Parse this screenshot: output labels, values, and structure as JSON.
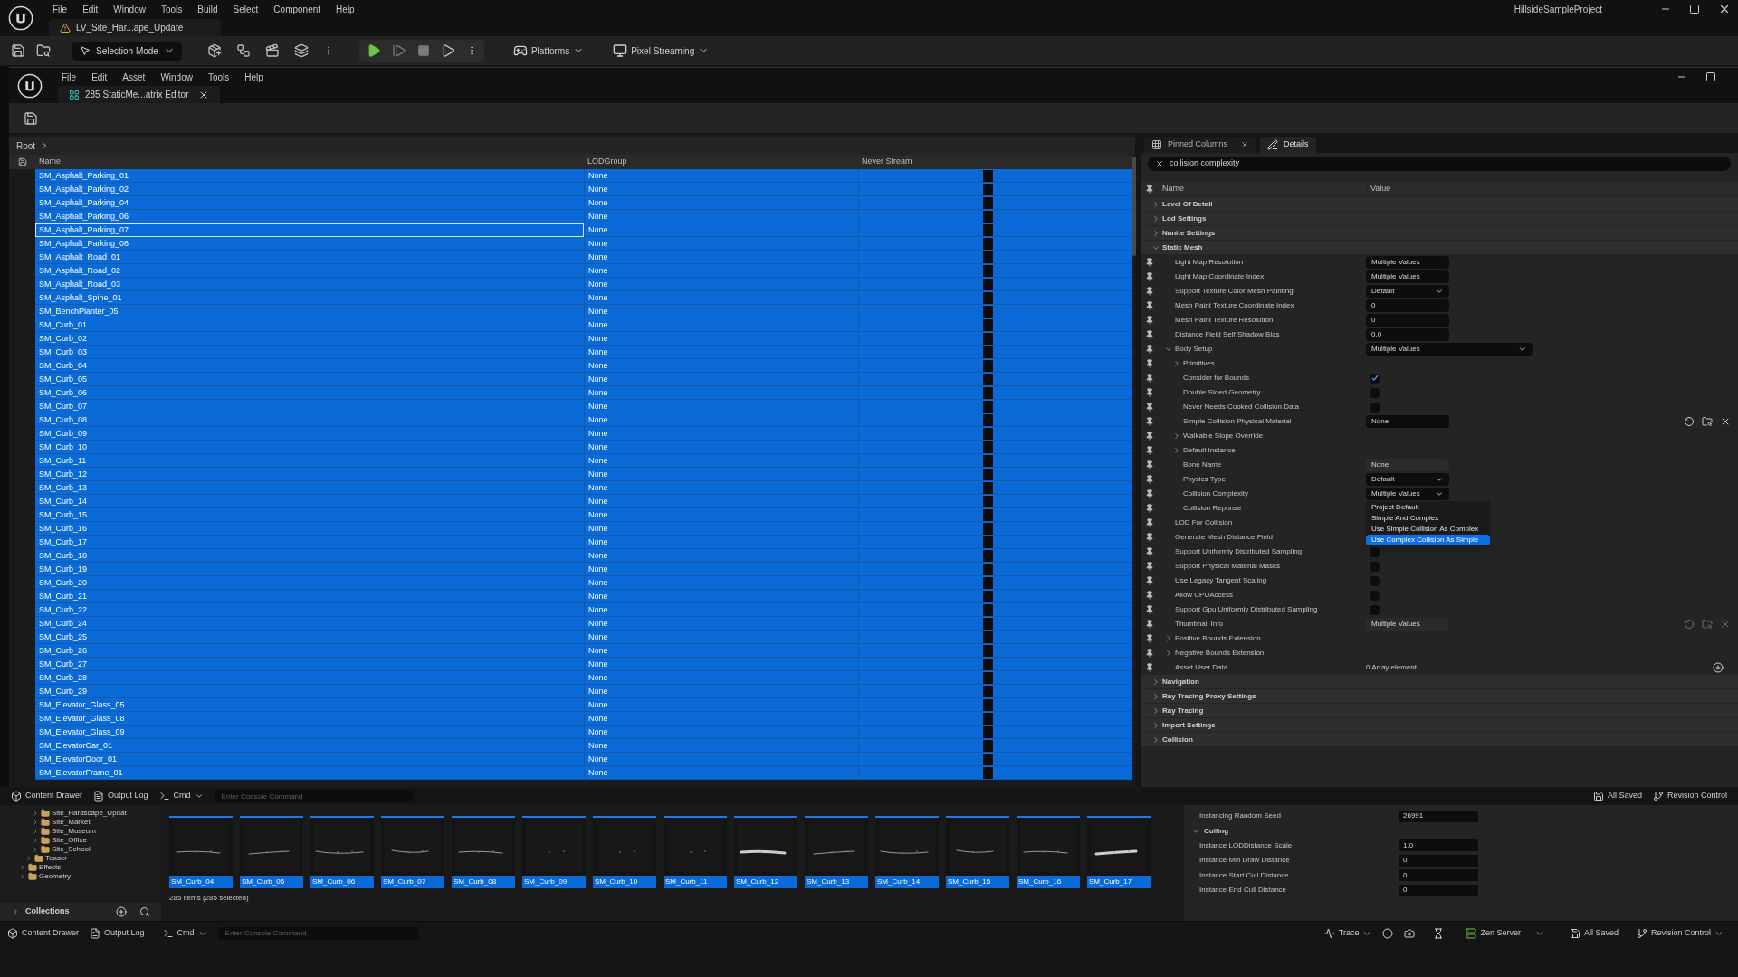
{
  "app": {
    "menu": [
      "File",
      "Edit",
      "Window",
      "Tools",
      "Build",
      "Select",
      "Component",
      "Help"
    ],
    "level_tab": "LV_Site_Har...ape_Update",
    "project": "HillsideSampleProject"
  },
  "toolbar": {
    "mode": "Selection Mode",
    "platforms": "Platforms",
    "streaming": "Pixel Streaming"
  },
  "editor": {
    "menu": [
      "File",
      "Edit",
      "Asset",
      "Window",
      "Tools",
      "Help"
    ],
    "tab": "285 StaticMe...atrix Editor",
    "breadcrumb": "Root",
    "table": {
      "columns": [
        "Name",
        "LODGroup",
        "Never Stream"
      ],
      "rows": [
        {
          "name": "SM_Asphalt_Parking_01",
          "lod_group": "None",
          "never_stream": false,
          "selected": true,
          "focused": false
        },
        {
          "name": "SM_Asphalt_Parking_02",
          "lod_group": "None",
          "never_stream": false,
          "selected": true,
          "focused": false
        },
        {
          "name": "SM_Asphalt_Parking_04",
          "lod_group": "None",
          "never_stream": false,
          "selected": true,
          "focused": false
        },
        {
          "name": "SM_Asphalt_Parking_06",
          "lod_group": "None",
          "never_stream": false,
          "selected": true,
          "focused": false
        },
        {
          "name": "SM_Asphalt_Parking_07",
          "lod_group": "None",
          "never_stream": false,
          "selected": true,
          "focused": true
        },
        {
          "name": "SM_Asphalt_Parking_08",
          "lod_group": "None",
          "never_stream": false,
          "selected": true,
          "focused": false
        },
        {
          "name": "SM_Asphalt_Road_01",
          "lod_group": "None",
          "never_stream": false,
          "selected": true,
          "focused": false
        },
        {
          "name": "SM_Asphalt_Road_02",
          "lod_group": "None",
          "never_stream": false,
          "selected": true,
          "focused": false
        },
        {
          "name": "SM_Asphalt_Road_03",
          "lod_group": "None",
          "never_stream": false,
          "selected": true,
          "focused": false
        },
        {
          "name": "SM_Asphalt_Spine_01",
          "lod_group": "None",
          "never_stream": false,
          "selected": true,
          "focused": false
        },
        {
          "name": "SM_BenchPlanter_05",
          "lod_group": "None",
          "never_stream": false,
          "selected": true,
          "focused": false
        },
        {
          "name": "SM_Curb_01",
          "lod_group": "None",
          "never_stream": false,
          "selected": true,
          "focused": false
        },
        {
          "name": "SM_Curb_02",
          "lod_group": "None",
          "never_stream": false,
          "selected": true,
          "focused": false
        },
        {
          "name": "SM_Curb_03",
          "lod_group": "None",
          "never_stream": false,
          "selected": true,
          "focused": false
        },
        {
          "name": "SM_Curb_04",
          "lod_group": "None",
          "never_stream": false,
          "selected": true,
          "focused": false
        },
        {
          "name": "SM_Curb_05",
          "lod_group": "None",
          "never_stream": false,
          "selected": true,
          "focused": false
        },
        {
          "name": "SM_Curb_06",
          "lod_group": "None",
          "never_stream": false,
          "selected": true,
          "focused": false
        },
        {
          "name": "SM_Curb_07",
          "lod_group": "None",
          "never_stream": false,
          "selected": true,
          "focused": false
        },
        {
          "name": "SM_Curb_08",
          "lod_group": "None",
          "never_stream": false,
          "selected": true,
          "focused": false
        },
        {
          "name": "SM_Curb_09",
          "lod_group": "None",
          "never_stream": false,
          "selected": true,
          "focused": false
        },
        {
          "name": "SM_Curb_10",
          "lod_group": "None",
          "never_stream": false,
          "selected": true,
          "focused": false
        },
        {
          "name": "SM_Curb_11",
          "lod_group": "None",
          "never_stream": false,
          "selected": true,
          "focused": false
        },
        {
          "name": "SM_Curb_12",
          "lod_group": "None",
          "never_stream": false,
          "selected": true,
          "focused": false
        },
        {
          "name": "SM_Curb_13",
          "lod_group": "None",
          "never_stream": false,
          "selected": true,
          "focused": false
        },
        {
          "name": "SM_Curb_14",
          "lod_group": "None",
          "never_stream": false,
          "selected": true,
          "focused": false
        },
        {
          "name": "SM_Curb_15",
          "lod_group": "None",
          "never_stream": false,
          "selected": true,
          "focused": false
        },
        {
          "name": "SM_Curb_16",
          "lod_group": "None",
          "never_stream": false,
          "selected": true,
          "focused": false
        },
        {
          "name": "SM_Curb_17",
          "lod_group": "None",
          "never_stream": false,
          "selected": true,
          "focused": false
        },
        {
          "name": "SM_Curb_18",
          "lod_group": "None",
          "never_stream": false,
          "selected": true,
          "focused": false
        },
        {
          "name": "SM_Curb_19",
          "lod_group": "None",
          "never_stream": false,
          "selected": true,
          "focused": false
        },
        {
          "name": "SM_Curb_20",
          "lod_group": "None",
          "never_stream": false,
          "selected": true,
          "focused": false
        },
        {
          "name": "SM_Curb_21",
          "lod_group": "None",
          "never_stream": false,
          "selected": true,
          "focused": false
        },
        {
          "name": "SM_Curb_22",
          "lod_group": "None",
          "never_stream": false,
          "selected": true,
          "focused": false
        },
        {
          "name": "SM_Curb_24",
          "lod_group": "None",
          "never_stream": false,
          "selected": true,
          "focused": false
        },
        {
          "name": "SM_Curb_25",
          "lod_group": "None",
          "never_stream": false,
          "selected": true,
          "focused": false
        },
        {
          "name": "SM_Curb_26",
          "lod_group": "None",
          "never_stream": false,
          "selected": true,
          "focused": false
        },
        {
          "name": "SM_Curb_27",
          "lod_group": "None",
          "never_stream": false,
          "selected": true,
          "focused": false
        },
        {
          "name": "SM_Curb_28",
          "lod_group": "None",
          "never_stream": false,
          "selected": true,
          "focused": false
        },
        {
          "name": "SM_Curb_29",
          "lod_group": "None",
          "never_stream": false,
          "selected": true,
          "focused": false
        },
        {
          "name": "SM_Elevator_Glass_05",
          "lod_group": "None",
          "never_stream": false,
          "selected": true,
          "focused": false
        },
        {
          "name": "SM_Elevator_Glass_08",
          "lod_group": "None",
          "never_stream": false,
          "selected": true,
          "focused": false
        },
        {
          "name": "SM_Elevator_Glass_09",
          "lod_group": "None",
          "never_stream": false,
          "selected": true,
          "focused": false
        },
        {
          "name": "SM_ElevatorCar_01",
          "lod_group": "None",
          "never_stream": false,
          "selected": true,
          "focused": false
        },
        {
          "name": "SM_ElevatorDoor_01",
          "lod_group": "None",
          "never_stream": false,
          "selected": true,
          "focused": false
        },
        {
          "name": "SM_ElevatorFrame_01",
          "lod_group": "None",
          "never_stream": false,
          "selected": true,
          "focused": false
        }
      ]
    }
  },
  "details": {
    "tabs": [
      {
        "label": "Pinned Columns",
        "selected": false,
        "kind": "grid"
      },
      {
        "label": "Details",
        "selected": true,
        "kind": "details"
      }
    ],
    "search": "collision complexity",
    "columns": [
      "Name",
      "Value"
    ],
    "items": [
      {
        "kind": "category",
        "label": "Level Of Detail",
        "expanded": false
      },
      {
        "kind": "category",
        "label": "Lod Settings",
        "expanded": false
      },
      {
        "kind": "category",
        "label": "Nanite Settings",
        "expanded": false
      },
      {
        "kind": "category",
        "label": "Static Mesh",
        "expanded": true,
        "children": [
          {
            "kind": "text",
            "label": "Light Map Resolution",
            "value": "Multiple Values"
          },
          {
            "kind": "text",
            "label": "Light Map Coordinate Index",
            "value": "Multiple Values"
          },
          {
            "kind": "dropdown",
            "label": "Support Texture Color Mesh Painting",
            "value": "Default"
          },
          {
            "kind": "text",
            "label": "Mesh Paint Texture Coordinate Index",
            "value": "0"
          },
          {
            "kind": "text",
            "label": "Mesh Paint Texture Resolution",
            "value": "0"
          },
          {
            "kind": "text",
            "label": "Distance Field Self Shadow Bias",
            "value": "0.0"
          },
          {
            "kind": "wide_dropdown",
            "label": "Body Setup",
            "value": "Multiple Values",
            "expanded": true,
            "children": [
              {
                "kind": "group",
                "label": "Primitives",
                "expanded": false
              },
              {
                "kind": "checkbox",
                "label": "Consider for Bounds",
                "checked": true
              },
              {
                "kind": "checkbox",
                "label": "Double Sided Geometry",
                "checked": false
              },
              {
                "kind": "checkbox",
                "label": "Never Needs Cooked Collision Data",
                "checked": false
              },
              {
                "kind": "asset",
                "label": "Simple Collision Physical Material",
                "value": "None"
              },
              {
                "kind": "group",
                "label": "Walkable Slope Override",
                "expanded": false
              },
              {
                "kind": "group",
                "label": "Default Instance",
                "expanded": false
              },
              {
                "kind": "readonly",
                "label": "Bone Name",
                "value": "None"
              },
              {
                "kind": "dropdown",
                "label": "Physics Type",
                "value": "Default"
              },
              {
                "kind": "dropdown",
                "label": "Collision Complexity",
                "value": "Multiple Values",
                "options": [
                  {
                    "label": "Project Default",
                    "selected": false
                  },
                  {
                    "label": "Simple And Complex",
                    "selected": false
                  },
                  {
                    "label": "Use Simple Collision As Complex",
                    "selected": false
                  },
                  {
                    "label": "Use Complex Collision As Simple",
                    "selected": true
                  }
                ]
              },
              {
                "kind": "group",
                "label": "Collision Reponse"
              }
            ]
          },
          {
            "kind": "group",
            "label": "LOD For Collision"
          },
          {
            "kind": "group",
            "label": "Generate Mesh Distance Field"
          },
          {
            "kind": "checkbox",
            "label": "Support Uniformly Distributed Sampling",
            "checked": false
          },
          {
            "kind": "checkbox",
            "label": "Support Physical Material Masks",
            "checked": false
          },
          {
            "kind": "checkbox",
            "label": "Use Legacy Tangent Scaling",
            "checked": false
          },
          {
            "kind": "checkbox",
            "label": "Allow CPUAccess",
            "checked": false
          },
          {
            "kind": "checkbox",
            "label": "Support Gpu Uniformly Distributed Sampling",
            "checked": false
          },
          {
            "kind": "asset_readonly",
            "label": "Thumbnail Info",
            "value": "Multiple Values"
          },
          {
            "kind": "group",
            "label": "Positive Bounds Extension",
            "expanded": false
          },
          {
            "kind": "group",
            "label": "Negative Bounds Extension",
            "expanded": false
          },
          {
            "kind": "array",
            "label": "Asset User Data",
            "value": "0 Array element"
          }
        ]
      },
      {
        "kind": "category",
        "label": "Navigation",
        "expanded": false
      },
      {
        "kind": "category",
        "label": "Ray Tracing Proxy Settings",
        "expanded": false
      },
      {
        "kind": "category",
        "label": "Ray Tracing",
        "expanded": false
      },
      {
        "kind": "category",
        "label": "Import Settings",
        "expanded": false
      },
      {
        "kind": "category",
        "label": "Collision",
        "expanded": false
      }
    ]
  },
  "drawer": {
    "tabs": [
      "Content Drawer",
      "Output Log"
    ],
    "cmd": "Cmd",
    "console_placeholder": "Enter Console Command",
    "saved": "All Saved",
    "revision": "Revision Control",
    "folders": [
      {
        "children": [
          {
            "children": [
              {
                "label": "Site_Hardscape_Updat",
                "expanded": false
              },
              {
                "label": "Site_Market",
                "expanded": false
              },
              {
                "label": "Site_Museum",
                "expanded": false
              },
              {
                "label": "Site_Office",
                "expanded": false
              },
              {
                "label": "Site_School",
                "expanded": false
              }
            ]
          },
          {
            "label": "Teaser",
            "expanded": false
          }
        ]
      },
      {
        "label": "Effects",
        "expanded": false
      },
      {
        "label": "Geometry",
        "expanded": false
      }
    ],
    "collections": "Collections",
    "assets": [
      {
        "label": "SM_Curb_04",
        "selected": true
      },
      {
        "label": "SM_Curb_05",
        "selected": true
      },
      {
        "label": "SM_Curb_06",
        "selected": true
      },
      {
        "label": "SM_Curb_07",
        "selected": true
      },
      {
        "label": "SM_Curb_08",
        "selected": true
      },
      {
        "label": "SM_Curb_09",
        "selected": true
      },
      {
        "label": "SM_Curb_10",
        "selected": true
      },
      {
        "label": "SM_Curb_11",
        "selected": true
      },
      {
        "label": "SM_Curb_12",
        "selected": true
      },
      {
        "label": "SM_Curb_13",
        "selected": true
      },
      {
        "label": "SM_Curb_14",
        "selected": true
      },
      {
        "label": "SM_Curb_15",
        "selected": true
      },
      {
        "label": "SM_Curb_16",
        "selected": true
      },
      {
        "label": "SM_Curb_17",
        "selected": true
      }
    ],
    "count": "285 items (285 selected)",
    "properties": [
      {
        "kind": "field",
        "label": "Instancing Random Seed",
        "value": "26991"
      },
      {
        "kind": "category",
        "label": "Culling"
      },
      {
        "kind": "field",
        "label": "Instance LODDistance Scale",
        "value": "1.0"
      },
      {
        "kind": "field",
        "label": "Instance Min Draw Distance",
        "value": "0"
      },
      {
        "kind": "field",
        "label": "Instance Start Cull Distance",
        "value": "0"
      },
      {
        "kind": "field",
        "label": "Instance End Cull Distance",
        "value": "0"
      }
    ]
  },
  "status_bar": {
    "tabs": [
      "Content Drawer",
      "Output Log"
    ],
    "cmd": "Cmd",
    "console_placeholder": "Enter Console Command",
    "trace": "Trace",
    "server": "Zen Server",
    "saved": "All Saved",
    "revision": "Revision Control"
  }
}
